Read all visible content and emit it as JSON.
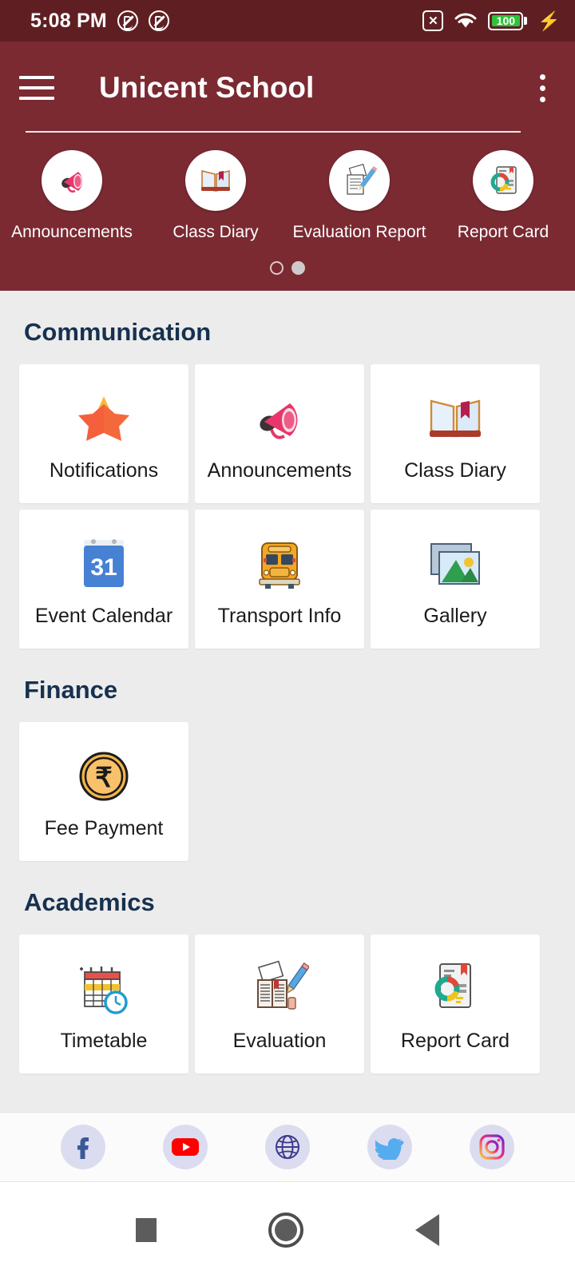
{
  "status_bar": {
    "time": "5:08 PM",
    "battery_level": "100",
    "icons": [
      "no-sound-icon",
      "no-sound-icon",
      "no-sim-icon",
      "wifi-icon",
      "battery-icon",
      "charging-bolt-icon"
    ]
  },
  "app_bar": {
    "title": "Unicent School",
    "menu_icon": "hamburger-icon",
    "overflow_icon": "kebab-icon",
    "background_color": "#7b2a32"
  },
  "carousel": {
    "items": [
      {
        "label": "Announcements",
        "icon": "megaphone-icon"
      },
      {
        "label": "Class Diary",
        "icon": "open-book-icon"
      },
      {
        "label": "Evaluation Report",
        "icon": "document-pencil-icon"
      },
      {
        "label": "Report Card",
        "icon": "report-card-icon"
      }
    ],
    "page_dots": 2,
    "active_dot": 1
  },
  "sections": [
    {
      "title": "Communication",
      "items": [
        {
          "label": "Notifications",
          "icon": "star-icon"
        },
        {
          "label": "Announcements",
          "icon": "megaphone-icon"
        },
        {
          "label": "Class Diary",
          "icon": "open-book-icon"
        },
        {
          "label": "Event Calendar",
          "icon": "calendar-31-icon"
        },
        {
          "label": "Transport Info",
          "icon": "school-bus-icon"
        },
        {
          "label": "Gallery",
          "icon": "photos-icon"
        }
      ]
    },
    {
      "title": "Finance",
      "items": [
        {
          "label": "Fee Payment",
          "icon": "rupee-coin-icon"
        }
      ]
    },
    {
      "title": "Academics",
      "items": [
        {
          "label": "Timetable",
          "icon": "timetable-clock-icon"
        },
        {
          "label": "Evaluation",
          "icon": "book-pencil-icon"
        },
        {
          "label": "Report Card",
          "icon": "report-card-icon"
        }
      ]
    }
  ],
  "social_bar": {
    "items": [
      {
        "name": "facebook",
        "icon": "facebook-icon"
      },
      {
        "name": "youtube",
        "icon": "youtube-icon"
      },
      {
        "name": "website",
        "icon": "globe-icon"
      },
      {
        "name": "twitter",
        "icon": "twitter-icon"
      },
      {
        "name": "instagram",
        "icon": "instagram-icon"
      }
    ]
  },
  "nav_bar": {
    "recents": "square-icon",
    "home": "circle-icon",
    "back": "triangle-left-icon"
  },
  "colors": {
    "header": "#7b2a32",
    "status_bar": "#5f1f22",
    "section_heading": "#17314f",
    "page_background": "#ececec",
    "card": "#ffffff"
  }
}
